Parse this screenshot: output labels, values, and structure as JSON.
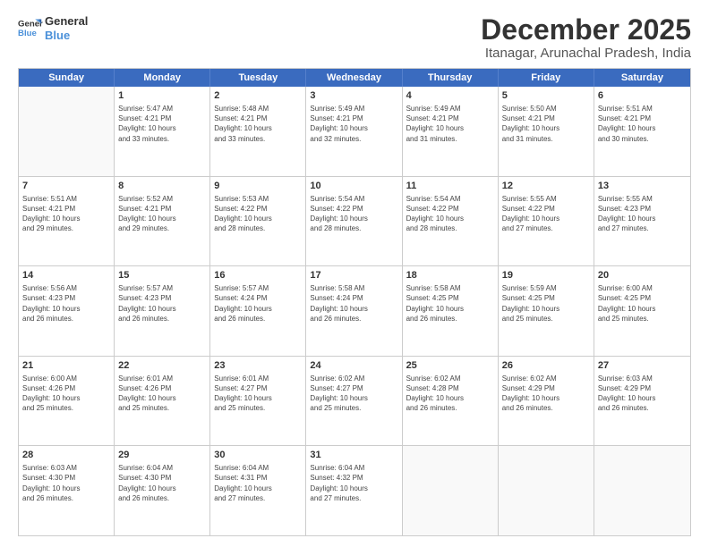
{
  "logo": {
    "line1": "General",
    "line2": "Blue"
  },
  "title": "December 2025",
  "subtitle": "Itanagar, Arunachal Pradesh, India",
  "days": [
    "Sunday",
    "Monday",
    "Tuesday",
    "Wednesday",
    "Thursday",
    "Friday",
    "Saturday"
  ],
  "weeks": [
    [
      {
        "num": "",
        "info": ""
      },
      {
        "num": "1",
        "info": "Sunrise: 5:47 AM\nSunset: 4:21 PM\nDaylight: 10 hours\nand 33 minutes."
      },
      {
        "num": "2",
        "info": "Sunrise: 5:48 AM\nSunset: 4:21 PM\nDaylight: 10 hours\nand 33 minutes."
      },
      {
        "num": "3",
        "info": "Sunrise: 5:49 AM\nSunset: 4:21 PM\nDaylight: 10 hours\nand 32 minutes."
      },
      {
        "num": "4",
        "info": "Sunrise: 5:49 AM\nSunset: 4:21 PM\nDaylight: 10 hours\nand 31 minutes."
      },
      {
        "num": "5",
        "info": "Sunrise: 5:50 AM\nSunset: 4:21 PM\nDaylight: 10 hours\nand 31 minutes."
      },
      {
        "num": "6",
        "info": "Sunrise: 5:51 AM\nSunset: 4:21 PM\nDaylight: 10 hours\nand 30 minutes."
      }
    ],
    [
      {
        "num": "7",
        "info": "Sunrise: 5:51 AM\nSunset: 4:21 PM\nDaylight: 10 hours\nand 29 minutes."
      },
      {
        "num": "8",
        "info": "Sunrise: 5:52 AM\nSunset: 4:21 PM\nDaylight: 10 hours\nand 29 minutes."
      },
      {
        "num": "9",
        "info": "Sunrise: 5:53 AM\nSunset: 4:22 PM\nDaylight: 10 hours\nand 28 minutes."
      },
      {
        "num": "10",
        "info": "Sunrise: 5:54 AM\nSunset: 4:22 PM\nDaylight: 10 hours\nand 28 minutes."
      },
      {
        "num": "11",
        "info": "Sunrise: 5:54 AM\nSunset: 4:22 PM\nDaylight: 10 hours\nand 28 minutes."
      },
      {
        "num": "12",
        "info": "Sunrise: 5:55 AM\nSunset: 4:22 PM\nDaylight: 10 hours\nand 27 minutes."
      },
      {
        "num": "13",
        "info": "Sunrise: 5:55 AM\nSunset: 4:23 PM\nDaylight: 10 hours\nand 27 minutes."
      }
    ],
    [
      {
        "num": "14",
        "info": "Sunrise: 5:56 AM\nSunset: 4:23 PM\nDaylight: 10 hours\nand 26 minutes."
      },
      {
        "num": "15",
        "info": "Sunrise: 5:57 AM\nSunset: 4:23 PM\nDaylight: 10 hours\nand 26 minutes."
      },
      {
        "num": "16",
        "info": "Sunrise: 5:57 AM\nSunset: 4:24 PM\nDaylight: 10 hours\nand 26 minutes."
      },
      {
        "num": "17",
        "info": "Sunrise: 5:58 AM\nSunset: 4:24 PM\nDaylight: 10 hours\nand 26 minutes."
      },
      {
        "num": "18",
        "info": "Sunrise: 5:58 AM\nSunset: 4:25 PM\nDaylight: 10 hours\nand 26 minutes."
      },
      {
        "num": "19",
        "info": "Sunrise: 5:59 AM\nSunset: 4:25 PM\nDaylight: 10 hours\nand 25 minutes."
      },
      {
        "num": "20",
        "info": "Sunrise: 6:00 AM\nSunset: 4:25 PM\nDaylight: 10 hours\nand 25 minutes."
      }
    ],
    [
      {
        "num": "21",
        "info": "Sunrise: 6:00 AM\nSunset: 4:26 PM\nDaylight: 10 hours\nand 25 minutes."
      },
      {
        "num": "22",
        "info": "Sunrise: 6:01 AM\nSunset: 4:26 PM\nDaylight: 10 hours\nand 25 minutes."
      },
      {
        "num": "23",
        "info": "Sunrise: 6:01 AM\nSunset: 4:27 PM\nDaylight: 10 hours\nand 25 minutes."
      },
      {
        "num": "24",
        "info": "Sunrise: 6:02 AM\nSunset: 4:27 PM\nDaylight: 10 hours\nand 25 minutes."
      },
      {
        "num": "25",
        "info": "Sunrise: 6:02 AM\nSunset: 4:28 PM\nDaylight: 10 hours\nand 26 minutes."
      },
      {
        "num": "26",
        "info": "Sunrise: 6:02 AM\nSunset: 4:29 PM\nDaylight: 10 hours\nand 26 minutes."
      },
      {
        "num": "27",
        "info": "Sunrise: 6:03 AM\nSunset: 4:29 PM\nDaylight: 10 hours\nand 26 minutes."
      }
    ],
    [
      {
        "num": "28",
        "info": "Sunrise: 6:03 AM\nSunset: 4:30 PM\nDaylight: 10 hours\nand 26 minutes."
      },
      {
        "num": "29",
        "info": "Sunrise: 6:04 AM\nSunset: 4:30 PM\nDaylight: 10 hours\nand 26 minutes."
      },
      {
        "num": "30",
        "info": "Sunrise: 6:04 AM\nSunset: 4:31 PM\nDaylight: 10 hours\nand 27 minutes."
      },
      {
        "num": "31",
        "info": "Sunrise: 6:04 AM\nSunset: 4:32 PM\nDaylight: 10 hours\nand 27 minutes."
      },
      {
        "num": "",
        "info": ""
      },
      {
        "num": "",
        "info": ""
      },
      {
        "num": "",
        "info": ""
      }
    ]
  ]
}
